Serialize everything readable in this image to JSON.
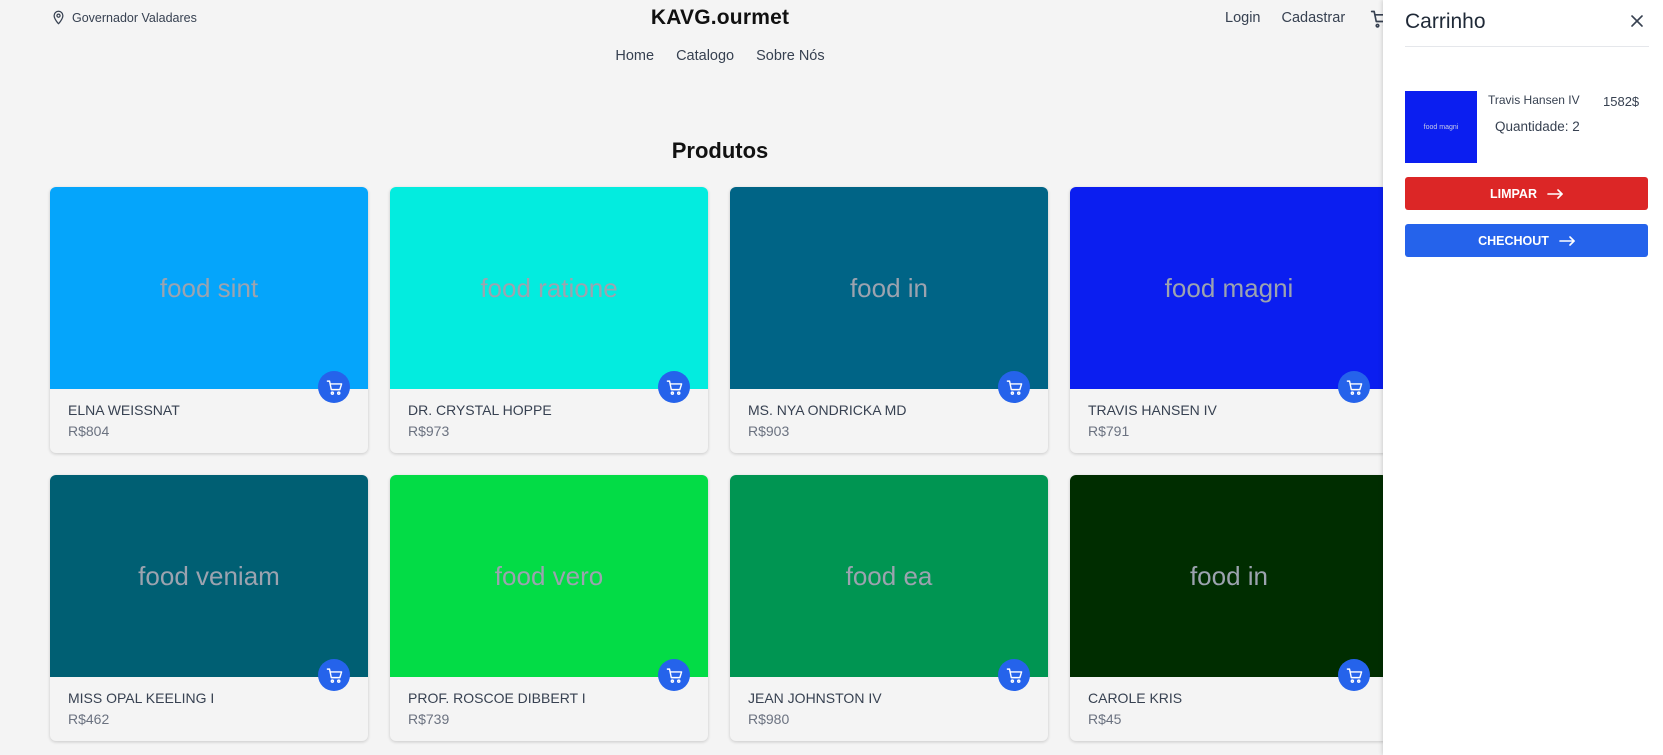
{
  "header": {
    "location": "Governador Valadares",
    "brand": "KAVG.ourmet",
    "login": "Login",
    "register": "Cadastrar"
  },
  "nav": {
    "home": "Home",
    "catalog": "Catalogo",
    "about": "Sobre Nós"
  },
  "products_title": "Produtos",
  "products": [
    {
      "name": "ELNA WEISSNAT",
      "price": "R$804",
      "image_text": "food sint",
      "color": "#05a5fb"
    },
    {
      "name": "DR. CRYSTAL HOPPE",
      "price": "R$973",
      "image_text": "food ratione",
      "color": "#03ecdf"
    },
    {
      "name": "MS. NYA ONDRICKA MD",
      "price": "R$903",
      "image_text": "food in",
      "color": "#006486"
    },
    {
      "name": "TRAVIS HANSEN IV",
      "price": "R$791",
      "image_text": "food magni",
      "color": "#0b1ef0"
    },
    {
      "name": "MISS OPAL KEELING I",
      "price": "R$462",
      "image_text": "food veniam",
      "color": "#005f73"
    },
    {
      "name": "PROF. ROSCOE DIBBERT I",
      "price": "R$739",
      "image_text": "food vero",
      "color": "#03dc46"
    },
    {
      "name": "JEAN JOHNSTON IV",
      "price": "R$980",
      "image_text": "food ea",
      "color": "#009552"
    },
    {
      "name": "CAROLE KRIS",
      "price": "R$45",
      "image_text": "food in",
      "color": "#002d00"
    }
  ],
  "cart": {
    "title": "Carrinho",
    "item": {
      "name": "Travis Hansen IV",
      "price": "1582$",
      "quantity": "Quantidade: 2",
      "image_text": "food magni",
      "color": "#0b1ef0"
    },
    "clear_label": "LIMPAR",
    "checkout_label": "CHECHOUT"
  },
  "colors": {
    "accent": "#2563eb",
    "danger": "#dc2626",
    "background": "#f4f4f4"
  }
}
